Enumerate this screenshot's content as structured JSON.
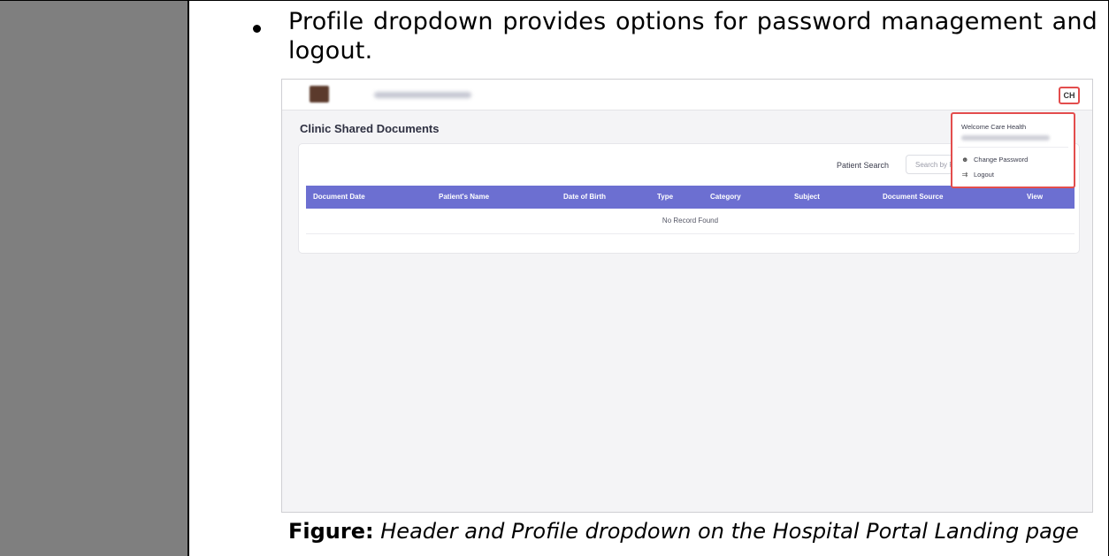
{
  "bullet": {
    "text": "Profile dropdown provides options for password management and logout."
  },
  "screenshot": {
    "avatar_initials": "CH",
    "page_title": "Clinic Shared Documents",
    "search": {
      "label": "Patient Search",
      "placeholder": "Search by Patient"
    },
    "table": {
      "columns": [
        "Document Date",
        "Patient's Name",
        "Date of Birth",
        "Type",
        "Category",
        "Subject",
        "Document Source",
        "View"
      ],
      "empty_message": "No Record Found"
    },
    "dropdown": {
      "welcome": "Welcome Care Health",
      "items": [
        {
          "label": "Change Password",
          "icon": "user-icon"
        },
        {
          "label": "Logout",
          "icon": "logout-icon"
        }
      ]
    },
    "colors": {
      "table_header": "#6c6fd1",
      "highlight": "#e34d4d"
    }
  },
  "caption": {
    "label": "Figure:",
    "text": "Header and Profile dropdown on the Hospital Portal Landing page"
  }
}
